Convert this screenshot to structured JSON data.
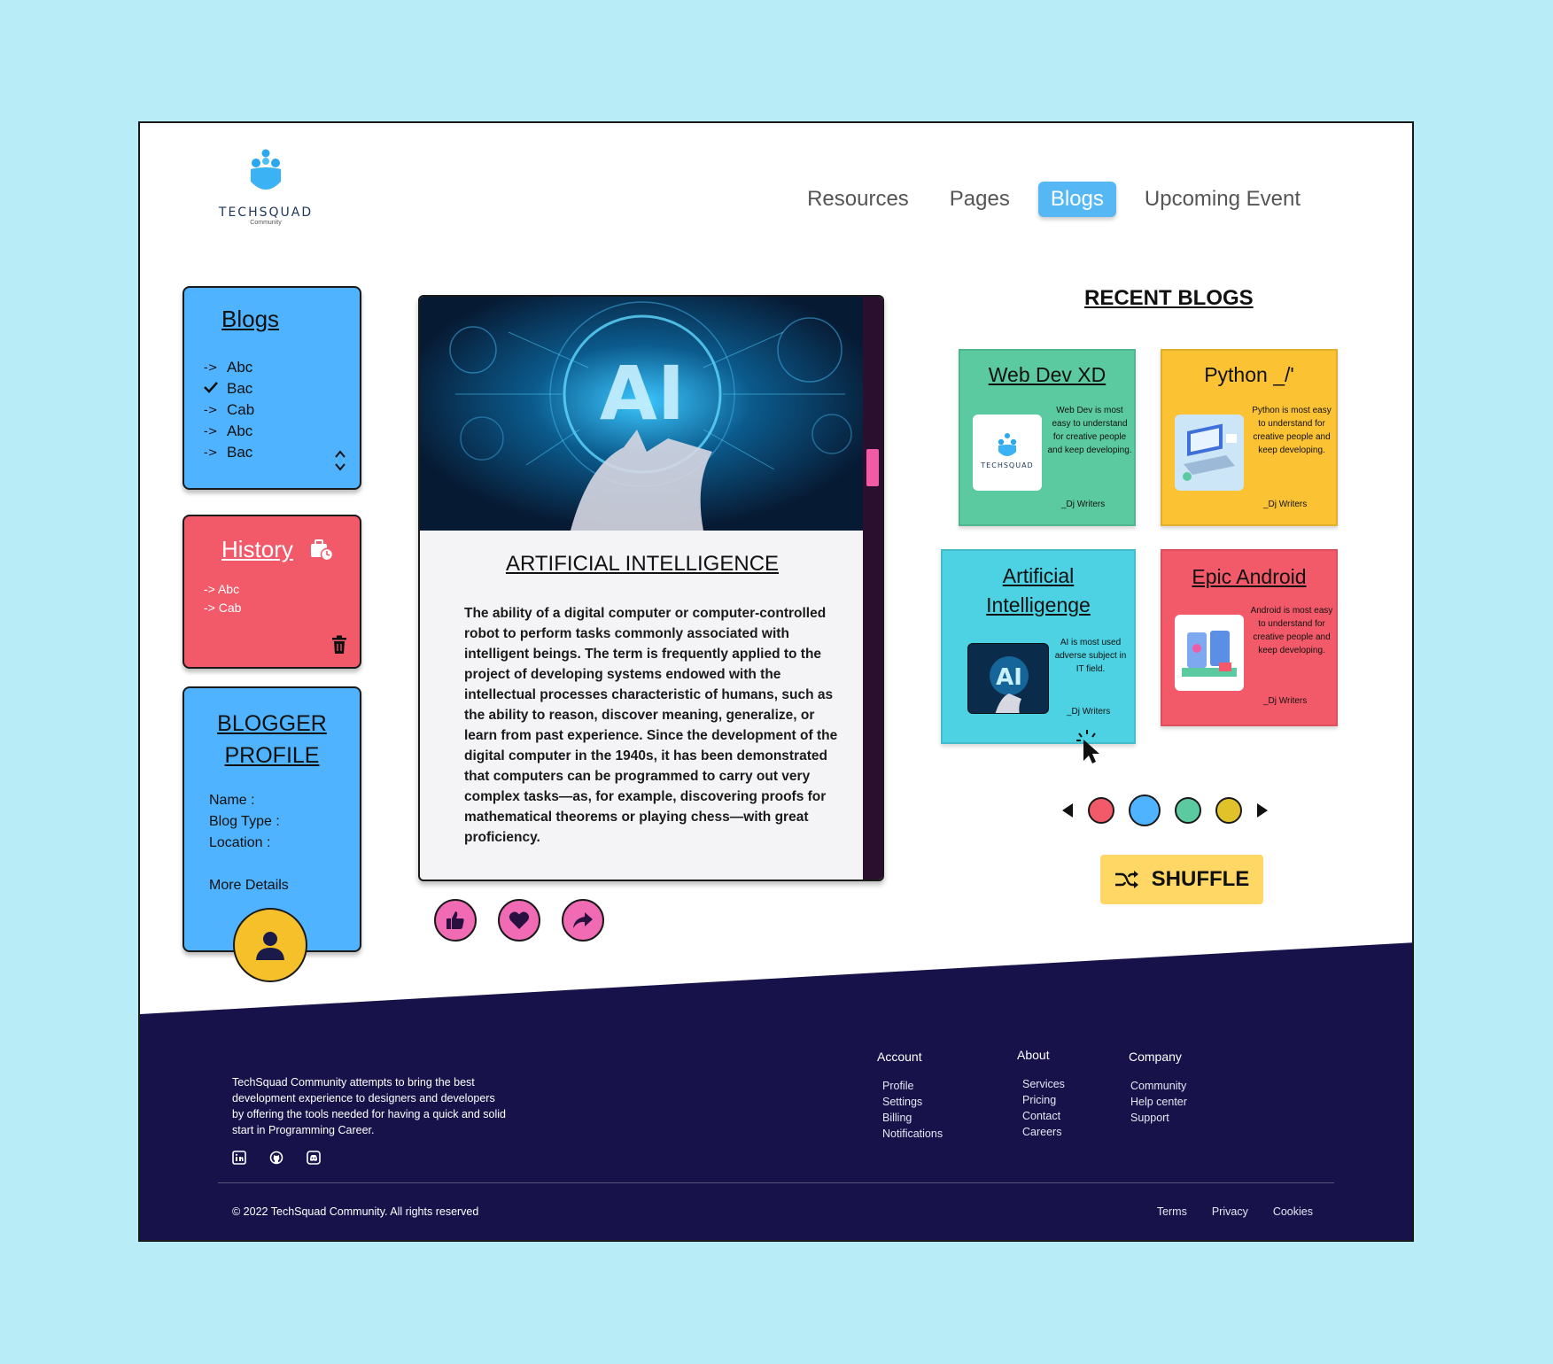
{
  "brand": {
    "name": "TECHSQUAD",
    "tagline": "Community"
  },
  "nav": {
    "items": [
      {
        "label": "Resources",
        "active": false
      },
      {
        "label": "Pages",
        "active": false
      },
      {
        "label": "Blogs",
        "active": true
      },
      {
        "label": "Upcoming Event",
        "active": false
      }
    ]
  },
  "sidebar": {
    "blogs": {
      "title": "Blogs",
      "items": [
        {
          "marker": "->",
          "label": "Abc"
        },
        {
          "marker": "check",
          "label": "Bac"
        },
        {
          "marker": "->",
          "label": "Cab"
        },
        {
          "marker": "->",
          "label": "Abc"
        },
        {
          "marker": "->",
          "label": "Bac"
        }
      ]
    },
    "history": {
      "title": "History",
      "items": [
        {
          "marker": "->",
          "label": "Abc"
        },
        {
          "marker": "->",
          "label": "Cab"
        }
      ]
    },
    "profile": {
      "title_line1": "BLOGGER",
      "title_line2": "PROFILE",
      "name_label": "Name :",
      "blog_type_label": "Blog Type :",
      "location_label": "Location :",
      "more": "More Details"
    }
  },
  "article": {
    "title": "ARTIFICIAL INTELLIGENCE",
    "image_label": "AI",
    "body": "The ability of a digital computer or computer-controlled robot to perform tasks commonly associated with intelligent beings. The term is frequently applied to the project of developing systems endowed with the intellectual processes characteristic of humans, such as the ability to reason, discover meaning, generalize, or learn from past experience. Since the development of the digital computer in the 1940s, it has been demonstrated that computers can be programmed to carry out very complex tasks—as, for example, discovering proofs for mathematical theorems or playing chess—with great proficiency."
  },
  "recent": {
    "title": "RECENT BLOGS",
    "cards": [
      {
        "title": "Web Dev XD",
        "desc": "Web Dev is most easy to understand for creative people and keep developing.",
        "author": "_Dj Writers",
        "color": "#5ccaa0"
      },
      {
        "title": "Python _/'",
        "desc": "Python is most easy to understand for creative people and keep developing.",
        "author": "_Dj Writers",
        "color": "#fbc233"
      },
      {
        "title_line1": "Artificial",
        "title_line2": "Intelligenge",
        "desc": "AI is most used adverse subject in IT field.",
        "author": "_Dj Writers",
        "color": "#4cd2e2"
      },
      {
        "title": "Epic Android",
        "desc": "Android is most easy to understand for creative people and keep developing.",
        "author": "_Dj Writers",
        "color": "#f25a6a"
      }
    ],
    "pager_colors": [
      "#f25a6a",
      "#4fb3ff",
      "#5ccaa0",
      "#e2c22a"
    ],
    "shuffle_label": "SHUFFLE"
  },
  "footer": {
    "about": "TechSquad Community attempts to bring the best development experience to designers and developers by offering the tools needed for having a quick and solid start in Programming Career.",
    "columns": [
      {
        "heading": "Account",
        "links": [
          "Profile",
          "Settings",
          "Billing",
          "Notifications"
        ]
      },
      {
        "heading": "About",
        "links": [
          "Services",
          "Pricing",
          "Contact",
          "Careers"
        ]
      },
      {
        "heading": "Company",
        "links": [
          "Community",
          "Help center",
          "Support"
        ]
      }
    ],
    "copyright": "© 2022 TechSquad Community. All rights reserved",
    "legal": [
      "Terms",
      "Privacy",
      "Cookies"
    ],
    "socials": [
      "linkedin-icon",
      "github-icon",
      "discord-icon"
    ]
  },
  "colors": {
    "accent": "#55b8f5",
    "footer": "#17134a",
    "blue_card": "#4fb3ff",
    "red_card": "#f25a6a"
  }
}
